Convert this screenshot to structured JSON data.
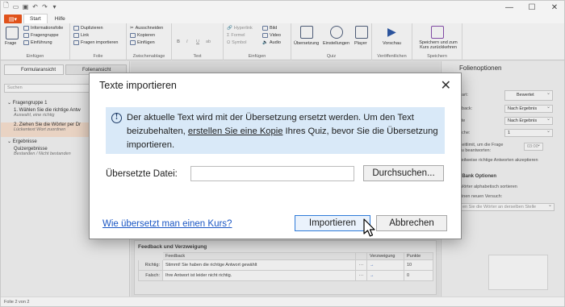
{
  "titlebar": {
    "qat_icons": [
      "app-menu-icon",
      "new-icon",
      "open-icon",
      "save-icon",
      "undo-icon",
      "redo-icon",
      "customize-icon"
    ],
    "window_controls": [
      "minimize-icon",
      "maximize-icon",
      "close-icon"
    ]
  },
  "tabs": {
    "file_label": "",
    "items": [
      "Start",
      "Hilfe"
    ],
    "active": "Start"
  },
  "ribbon": {
    "groups": {
      "einfuegen1": {
        "label": "Einfügen",
        "big": "Frage",
        "items": [
          "Informationsfolie",
          "Fragengruppe",
          "Einführung"
        ]
      },
      "folie": {
        "label": "Folie",
        "items": [
          "Duplizieren",
          "Link",
          "Fragen importieren"
        ]
      },
      "zwischenablage": {
        "label": "Zwischenablage",
        "items": [
          "Ausschneiden",
          "Kopieren",
          "Einfügen"
        ]
      },
      "text": {
        "label": "Text",
        "items": [
          "B",
          "I",
          "U",
          "ab"
        ]
      },
      "einfuegen2": {
        "label": "Einfügen",
        "items": [
          "Hyperlink",
          "Formel",
          "Symbol",
          "Bild",
          "Video",
          "Audio"
        ]
      },
      "quiz": {
        "label": "Quiz",
        "items": [
          "Übersetzung",
          "Einstellungen",
          "Player"
        ]
      },
      "veroeffentlichen": {
        "label": "Veröffentlichen",
        "items": [
          "Vorschau"
        ]
      },
      "speichern": {
        "label": "Speichern",
        "items": [
          "Speichern und zum Kurs zurückkehren"
        ]
      }
    }
  },
  "left_panel": {
    "view_buttons": [
      "Formularansicht",
      "Folienansicht"
    ],
    "search_placeholder": "Suchen",
    "groups": [
      {
        "title": "Fragengruppe 1",
        "items": [
          {
            "title": "1. Wählen Sie die richtige Antw",
            "subtitle": "Auswahl, eine richtig"
          },
          {
            "title": "2. Ziehen Sie die Wörter per Dr",
            "subtitle": "Lückentext Wort zuordnen"
          }
        ]
      },
      {
        "title": "Ergebnisse",
        "items": [
          {
            "title": "Quizergebnisse",
            "subtitle": "Bestanden / Nicht bestanden"
          }
        ]
      }
    ]
  },
  "feedback": {
    "title": "Feedback und Verzweigung",
    "headers": [
      "Feedback",
      "Verzweigung",
      "Punkte"
    ],
    "rows": [
      {
        "label": "Richtig:",
        "text": "Stimmt! Sie haben die richtige Antwort gewählt",
        "more": "···",
        "branch": "→",
        "points": "10"
      },
      {
        "label": "Falsch:",
        "text": "Ihre Antwort ist leider nicht richtig.",
        "more": "···",
        "branch": "→",
        "points": "0"
      }
    ]
  },
  "right_panel": {
    "title": "Folienoptionen",
    "rows": [
      {
        "label": "nart:",
        "value": "Bewertet"
      },
      {
        "label": "dback:",
        "value": "Nach Ergebnis"
      },
      {
        "label": "kte",
        "value": "Nach Ergebnis"
      },
      {
        "label": "uche:",
        "value": "1"
      }
    ],
    "time_label": "Zeitlimit, um die Frage zu beantworten:",
    "time_value": "03:00",
    "partial_label": "Teilweise richtige Antworten akzeptieren",
    "word_options_title": "l Bank Optionen",
    "opt1": "Wörter alphabetisch sortieren",
    "opt2": "einen neuen Versuch:",
    "opt3": "en Sie die Wörter an derselben Stelle"
  },
  "statusbar": {
    "text": "Folie 2 von 2"
  },
  "dialog": {
    "title": "Texte importieren",
    "info_part1": "Der aktuelle Text wird mit der Übersetzung ersetzt werden. Um den Text beizubehalten, ",
    "info_link": "erstellen Sie eine Kopie",
    "info_part2": " Ihres Quiz, bevor Sie die Übersetzung importieren.",
    "file_label": "Übersetzte Datei:",
    "file_value": "",
    "browse_label": "Durchsuchen...",
    "help_link": "Wie übersetzt man einen Kurs?",
    "import_label": "Importieren",
    "cancel_label": "Abbrechen"
  }
}
